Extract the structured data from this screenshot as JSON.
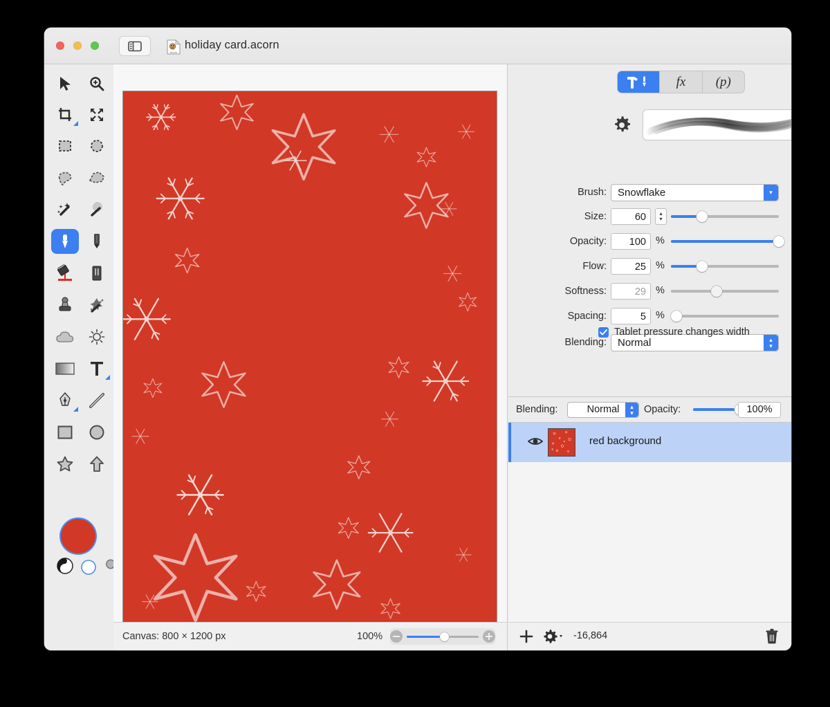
{
  "window": {
    "title": "holiday card.acorn",
    "traffic_lights": [
      "close",
      "minimize",
      "zoom"
    ],
    "sidebar_toggle": "sidebar-toggle"
  },
  "tools": [
    {
      "name": "move-tool",
      "icon": "arrow-pointer-icon",
      "selected": false,
      "badge": false
    },
    {
      "name": "zoom-tool",
      "icon": "magnifier-plus-icon",
      "selected": false,
      "badge": false
    },
    {
      "name": "crop-tool",
      "icon": "crop-icon",
      "selected": false,
      "badge": true
    },
    {
      "name": "transform-tool",
      "icon": "move-arrows-icon",
      "selected": false,
      "badge": false
    },
    {
      "name": "rectangular-select-tool",
      "icon": "marquee-rect-icon",
      "selected": false,
      "badge": false
    },
    {
      "name": "elliptical-select-tool",
      "icon": "marquee-ellipse-icon",
      "selected": false,
      "badge": false
    },
    {
      "name": "lasso-tool",
      "icon": "lasso-icon",
      "selected": false,
      "badge": false
    },
    {
      "name": "polygon-select-tool",
      "icon": "polygon-lasso-icon",
      "selected": false,
      "badge": false
    },
    {
      "name": "magic-wand-tool",
      "icon": "magic-wand-icon",
      "selected": false,
      "badge": false
    },
    {
      "name": "instant-alpha-tool",
      "icon": "instant-alpha-icon",
      "selected": false,
      "badge": false
    },
    {
      "name": "brush-tool",
      "icon": "paintbrush-icon",
      "selected": true,
      "badge": false
    },
    {
      "name": "pencil-tool",
      "icon": "pencil-icon",
      "selected": false,
      "badge": false
    },
    {
      "name": "paint-bucket-tool",
      "icon": "paint-bucket-icon",
      "selected": false,
      "badge": false
    },
    {
      "name": "eraser-tool",
      "icon": "eraser-icon",
      "selected": false,
      "badge": false
    },
    {
      "name": "clone-stamp-tool",
      "icon": "clone-stamp-icon",
      "selected": false,
      "badge": false
    },
    {
      "name": "smudge-tool",
      "icon": "splatter-icon",
      "selected": false,
      "badge": false
    },
    {
      "name": "blur-tool",
      "icon": "cloud-icon",
      "selected": false,
      "badge": false
    },
    {
      "name": "dodge-burn-tool",
      "icon": "sun-icon",
      "selected": false,
      "badge": false
    },
    {
      "name": "gradient-tool",
      "icon": "gradient-icon",
      "selected": false,
      "badge": false
    },
    {
      "name": "text-tool",
      "icon": "text-t-icon",
      "selected": false,
      "badge": true
    },
    {
      "name": "bezier-pen-tool",
      "icon": "fountain-pen-icon",
      "selected": false,
      "badge": true
    },
    {
      "name": "line-tool",
      "icon": "line-icon",
      "selected": false,
      "badge": false
    },
    {
      "name": "rectangle-shape-tool",
      "icon": "rectangle-icon",
      "selected": false,
      "badge": false
    },
    {
      "name": "ellipse-shape-tool",
      "icon": "ellipse-icon",
      "selected": false,
      "badge": false
    },
    {
      "name": "star-shape-tool",
      "icon": "star-icon",
      "selected": false,
      "badge": false
    },
    {
      "name": "arrow-shape-tool",
      "icon": "arrow-up-icon",
      "selected": false,
      "badge": false
    }
  ],
  "color_controls": {
    "foreground_color": "#d23826",
    "swap_icon": "half-circle-icon",
    "background_color": "#ffffff",
    "loupe_icon": "magnifier-icon"
  },
  "canvas": {
    "background_color": "#d23826",
    "stroke_color": "#f6dcd6",
    "size_label": "Canvas: 800 × 1200 px",
    "zoom_label": "100%",
    "zoom_out_icon": "zoom-out-icon",
    "zoom_in_icon": "zoom-in-icon"
  },
  "inspector": {
    "tabs": [
      {
        "label": "tool-options",
        "icon": "hammer-pen-icon",
        "active": true
      },
      {
        "label": "fx",
        "icon": "fx-icon",
        "active": false
      },
      {
        "label": "(p)",
        "icon": "palette-p-icon",
        "active": false
      }
    ],
    "gear_icon": "gear-icon",
    "brush_preview": "brush-stroke-preview",
    "fields": [
      {
        "label": "Brush:",
        "type": "popup",
        "value": "Snowflake"
      },
      {
        "label": "Size:",
        "type": "stepper-slider",
        "value": "60",
        "unit": "",
        "slider_pct": 29,
        "enabled": true
      },
      {
        "label": "Opacity:",
        "type": "slider",
        "value": "100",
        "unit": "%",
        "slider_pct": 100,
        "enabled": true
      },
      {
        "label": "Flow:",
        "type": "slider",
        "value": "25",
        "unit": "%",
        "slider_pct": 29,
        "enabled": true
      },
      {
        "label": "Softness:",
        "type": "slider",
        "value": "29",
        "unit": "%",
        "slider_pct": 42,
        "enabled": false
      },
      {
        "label": "Spacing:",
        "type": "slider",
        "value": "5",
        "unit": "%",
        "slider_pct": 5,
        "enabled": true
      },
      {
        "label": "Blending:",
        "type": "popup",
        "value": "Normal"
      }
    ],
    "tablet_checkbox": {
      "label": "Tablet pressure changes width",
      "checked": true
    }
  },
  "layers": {
    "blending_label": "Blending:",
    "blending_value": "Normal",
    "opacity_label": "Opacity:",
    "opacity_value": "100%",
    "opacity_slider_pct": 100,
    "items": [
      {
        "name": "red background",
        "visible": true,
        "visibility_icon": "eye-icon",
        "thumbnail": "red-layer-thumbnail",
        "selected": true
      }
    ],
    "add_icon": "plus-icon",
    "settings_icon": "gear-dropdown-icon",
    "memory_label": "-16,864",
    "delete_icon": "trash-icon"
  },
  "theme": {
    "accent": "#3b7ff0",
    "window_bg": "#ececec",
    "panel_bg": "#f4f4f4",
    "selection_bg": "#bdd2f7"
  }
}
